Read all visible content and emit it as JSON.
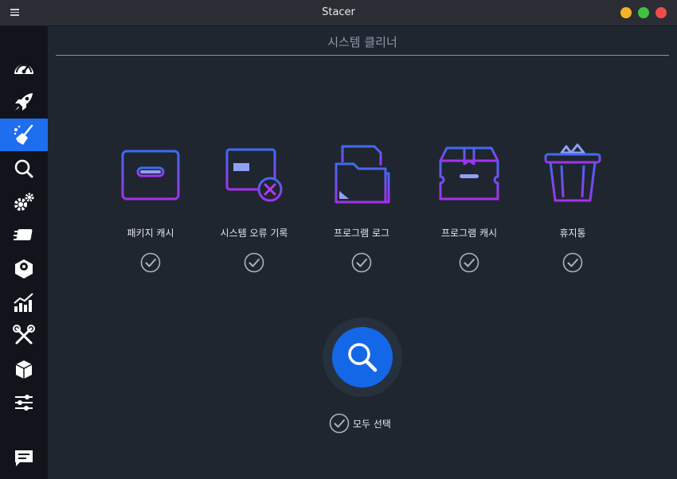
{
  "window": {
    "title": "Stacer",
    "controls": {
      "minimize_color": "#f4b425",
      "maximize_color": "#3fc240",
      "close_color": "#ef4b4b"
    }
  },
  "sidebar": {
    "active_index": 2,
    "accent": "#1e6ef0",
    "items": [
      {
        "icon": "dashboard-gauge-icon"
      },
      {
        "icon": "rocket-icon"
      },
      {
        "icon": "broom-cleaner-icon"
      },
      {
        "icon": "search-icon"
      },
      {
        "icon": "gears-icon"
      },
      {
        "icon": "resources-icon"
      },
      {
        "icon": "uninstaller-icon"
      },
      {
        "icon": "chart-icon"
      },
      {
        "icon": "tools-icon"
      },
      {
        "icon": "package-icon"
      },
      {
        "icon": "settings-sliders-icon"
      },
      {
        "icon": "feedback-icon"
      }
    ]
  },
  "main": {
    "title": "시스템 클리너",
    "categories": [
      {
        "label": "패키지 캐시",
        "checked": true,
        "icon": "package-cache-icon"
      },
      {
        "label": "시스템 오류 기록",
        "checked": true,
        "icon": "crash-reports-icon"
      },
      {
        "label": "프로그램 로그",
        "checked": true,
        "icon": "app-logs-icon"
      },
      {
        "label": "프로그램 캐시",
        "checked": true,
        "icon": "app-cache-icon"
      },
      {
        "label": "휴지통",
        "checked": true,
        "icon": "trash-icon"
      }
    ],
    "scan_button": {
      "icon": "search-icon"
    },
    "select_all": {
      "label": "모두 선택",
      "checked": true
    }
  }
}
